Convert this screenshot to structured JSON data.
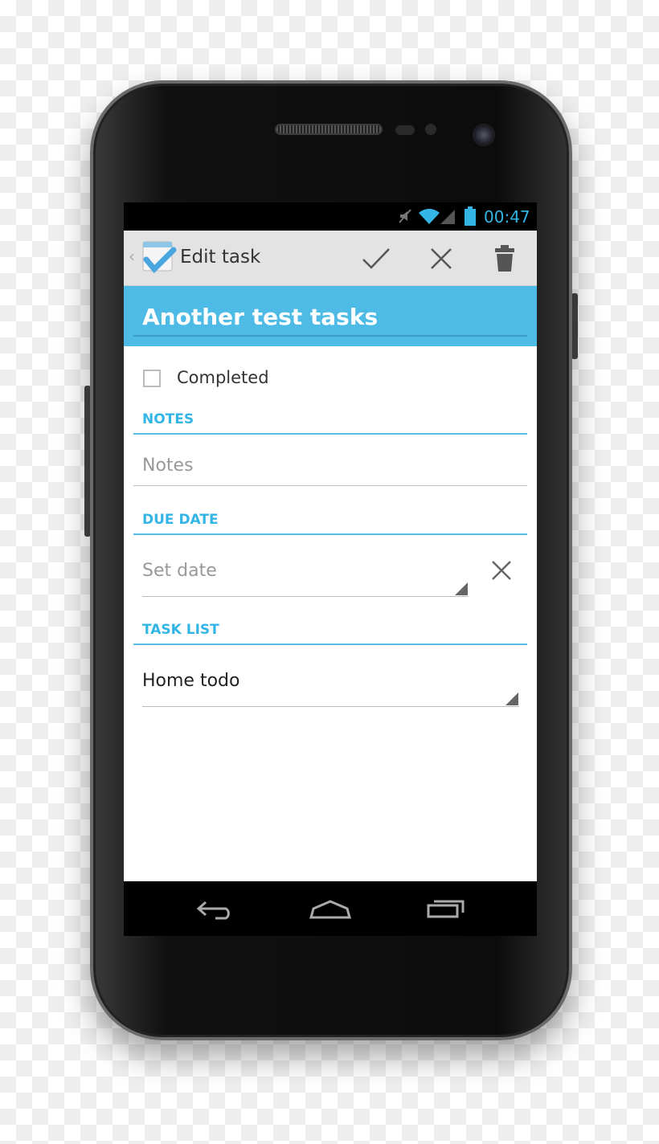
{
  "status_bar": {
    "time": "00:47",
    "icons": [
      "mute-icon",
      "wifi-icon",
      "signal-icon",
      "battery-icon"
    ]
  },
  "action_bar": {
    "title": "Edit task",
    "actions": [
      "check-icon",
      "close-icon",
      "trash-icon"
    ]
  },
  "task": {
    "title": "Another test tasks"
  },
  "completed": {
    "label": "Completed",
    "checked": false
  },
  "notes": {
    "header": "NOTES",
    "placeholder": "Notes"
  },
  "due_date": {
    "header": "DUE DATE",
    "placeholder": "Set date"
  },
  "task_list": {
    "header": "TASK LIST",
    "value": "Home todo"
  },
  "colors": {
    "accent": "#33b5e5",
    "title_bg": "#4ebbe6"
  }
}
